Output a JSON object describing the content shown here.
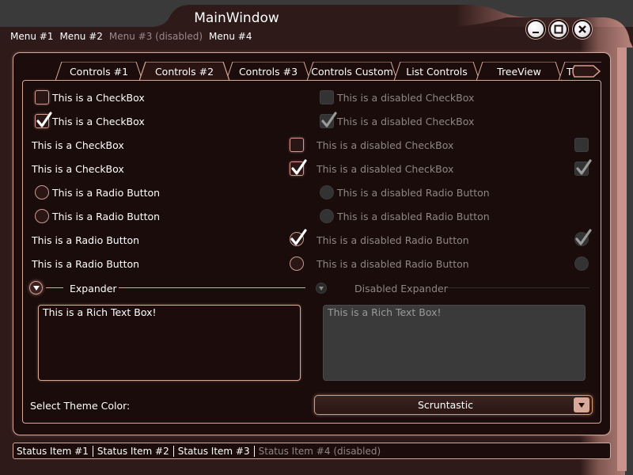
{
  "window": {
    "title": "MainWindow"
  },
  "menu": [
    "Menu #1",
    "Menu #2",
    "Menu #3 (disabled)",
    "Menu #4"
  ],
  "tabs": [
    "Controls #1",
    "Controls #2",
    "Controls #3",
    "Controls Custom",
    "List Controls",
    "TreeView",
    "T"
  ],
  "active_tab": "Controls #2",
  "left": {
    "checkbox_label": "This is a CheckBox",
    "radio_label": "This is a Radio Button"
  },
  "right": {
    "checkbox_label": "This is a disabled CheckBox",
    "radio_label": "This is a disabled Radio Button"
  },
  "expander": {
    "label": "Expander",
    "disabled_label": "Disabled Expander"
  },
  "rich_text": {
    "value": "This is a Rich Text Box!",
    "disabled_value": "This is a Rich Text Box!"
  },
  "theme": {
    "label": "Select Theme Color:",
    "selected": "Scruntastic"
  },
  "status": [
    "Status Item #1",
    "Status Item #2",
    "Status Item #3",
    "Status Item #4 (disabled)"
  ],
  "colors": {
    "accent": "#d6a89a",
    "background": "#1c0d0c",
    "chrome": "#2a1816"
  }
}
